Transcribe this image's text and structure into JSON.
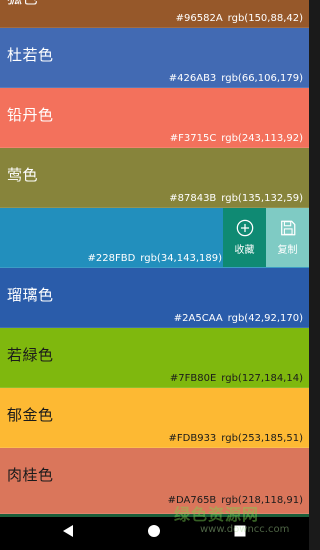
{
  "colors": [
    {
      "name": "狐色",
      "hex": "#96582A",
      "rgb": "rgb(150,88,42)",
      "bg": "#96582A",
      "text": "light"
    },
    {
      "name": "杜若色",
      "hex": "#426AB3",
      "rgb": "rgb(66,106,179)",
      "bg": "#426AB3",
      "text": "light"
    },
    {
      "name": "铅丹色",
      "hex": "#F3715C",
      "rgb": "rgb(243,113,92)",
      "bg": "#F3715C",
      "text": "light"
    },
    {
      "name": "莺色",
      "hex": "#87843B",
      "rgb": "rgb(135,132,59)",
      "bg": "#87843B",
      "text": "light"
    },
    {
      "name": "",
      "hex": "#228FBD",
      "rgb": "rgb(34,143,189)",
      "bg": "#228FBD",
      "text": "light"
    },
    {
      "name": "瑠璃色",
      "hex": "#2A5CAA",
      "rgb": "rgb(42,92,170)",
      "bg": "#2A5CAA",
      "text": "light"
    },
    {
      "name": "若緑色",
      "hex": "#7FB80E",
      "rgb": "rgb(127,184,14)",
      "bg": "#7FB80E",
      "text": "dark"
    },
    {
      "name": "郁金色",
      "hex": "#FDB933",
      "rgb": "rgb(253,185,51)",
      "bg": "#FDB933",
      "text": "dark"
    },
    {
      "name": "肉桂色",
      "hex": "#DA765B",
      "rgb": "rgb(218,118,91)",
      "bg": "#DA765B",
      "text": "dark"
    }
  ],
  "actions": {
    "favorite_label": "收藏",
    "copy_label": "复制",
    "favorite_icon": "plus-circle-icon",
    "copy_icon": "save-icon",
    "favorite_color": "#0F8A73",
    "copy_color": "#7FCBC4"
  },
  "navbar": {
    "back_icon": "back-triangle-icon",
    "home_icon": "home-circle-icon",
    "recents_icon": "recents-square-icon"
  },
  "watermark": {
    "text": "绿色资源网",
    "url": "www.downcc.com"
  }
}
